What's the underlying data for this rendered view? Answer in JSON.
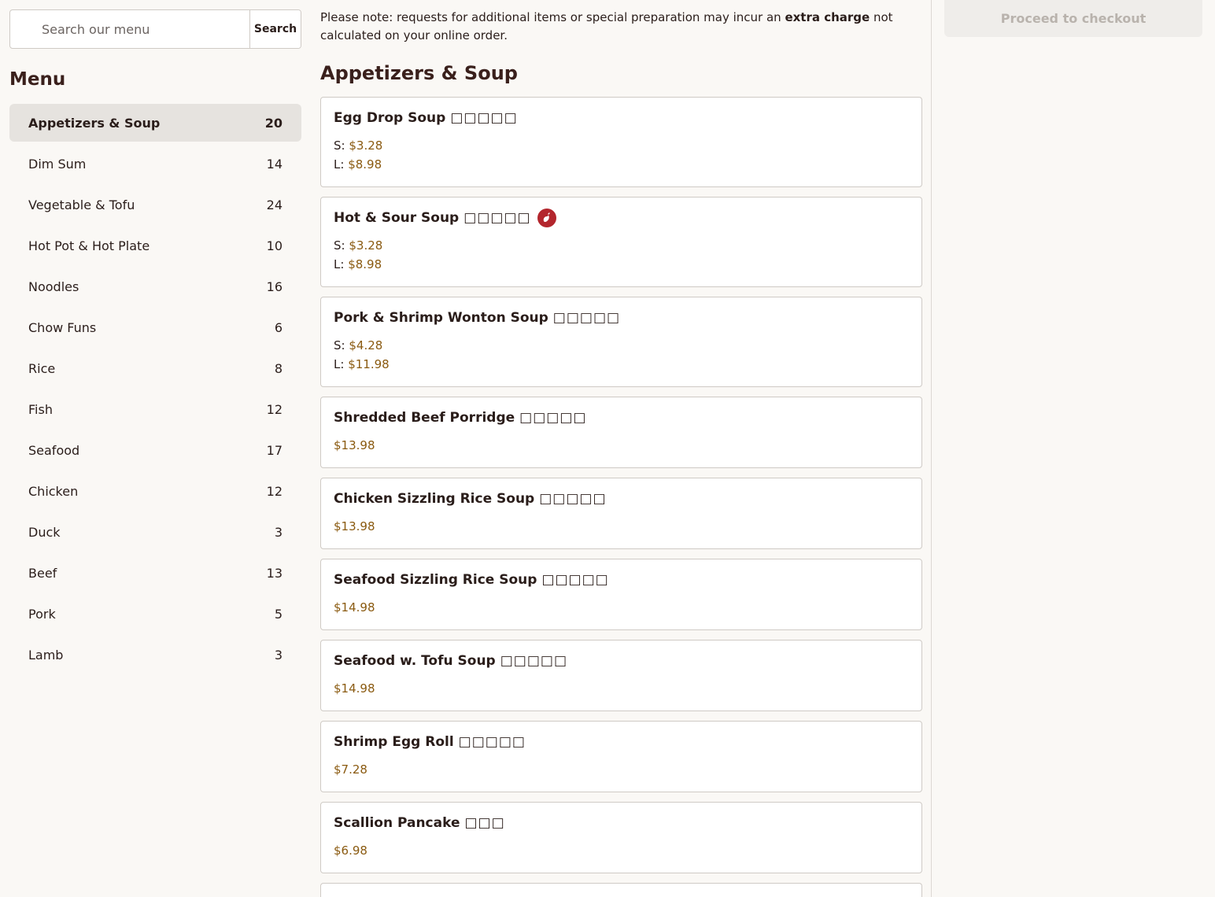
{
  "search": {
    "placeholder": "Search our menu",
    "button_label": "Search"
  },
  "sidebar": {
    "heading": "Menu",
    "categories": [
      {
        "label": "Appetizers & Soup",
        "count": "20"
      },
      {
        "label": "Dim Sum",
        "count": "14"
      },
      {
        "label": "Vegetable & Tofu",
        "count": "24"
      },
      {
        "label": "Hot Pot & Hot Plate",
        "count": "10"
      },
      {
        "label": "Noodles",
        "count": "16"
      },
      {
        "label": "Chow Funs",
        "count": "6"
      },
      {
        "label": "Rice",
        "count": "8"
      },
      {
        "label": "Fish",
        "count": "12"
      },
      {
        "label": "Seafood",
        "count": "17"
      },
      {
        "label": "Chicken",
        "count": "12"
      },
      {
        "label": "Duck",
        "count": "3"
      },
      {
        "label": "Beef",
        "count": "13"
      },
      {
        "label": "Pork",
        "count": "5"
      },
      {
        "label": "Lamb",
        "count": "3"
      }
    ]
  },
  "notice": {
    "before": "Please note: requests for additional items or special preparation may incur an ",
    "bold": "extra charge",
    "after": " not calculated on your online order."
  },
  "section": {
    "title": "Appetizers & Soup",
    "items": [
      {
        "name": "Egg Drop Soup",
        "cn": "□□□□□",
        "sizes": [
          {
            "label": "S:",
            "price": "$3.28"
          },
          {
            "label": "L:",
            "price": "$8.98"
          }
        ]
      },
      {
        "name": "Hot & Sour Soup",
        "cn": "□□□□□",
        "spicy_icon": "chili-pepper-icon",
        "sizes": [
          {
            "label": "S:",
            "price": "$3.28"
          },
          {
            "label": "L:",
            "price": "$8.98"
          }
        ]
      },
      {
        "name": "Pork & Shrimp Wonton Soup",
        "cn": "□□□□□",
        "sizes": [
          {
            "label": "S:",
            "price": "$4.28"
          },
          {
            "label": "L:",
            "price": "$11.98"
          }
        ]
      },
      {
        "name": "Shredded Beef Porridge",
        "cn": "□□□□□",
        "price": "$13.98"
      },
      {
        "name": "Chicken Sizzling Rice Soup",
        "cn": "□□□□□",
        "price": "$13.98"
      },
      {
        "name": "Seafood Sizzling Rice Soup",
        "cn": "□□□□□",
        "price": "$14.98"
      },
      {
        "name": "Seafood w. Tofu Soup",
        "cn": "□□□□□",
        "price": "$14.98"
      },
      {
        "name": "Shrimp Egg Roll",
        "cn": "□□□□□",
        "price": "$7.28"
      },
      {
        "name": "Scallion Pancake",
        "cn": "□□□",
        "price": "$6.98"
      }
    ]
  },
  "checkout": {
    "label": "Proceed to checkout"
  },
  "colors": {
    "price": "#8a5a10",
    "spicy": "#b3262d",
    "active_bg": "#e6e3df"
  }
}
